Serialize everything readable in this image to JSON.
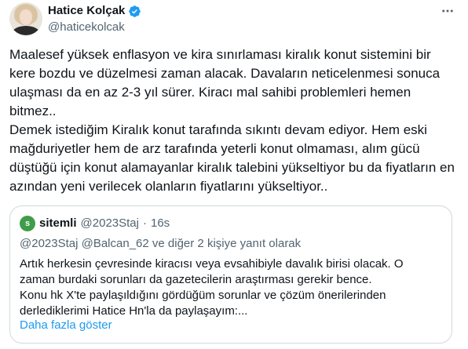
{
  "author": {
    "display_name": "Hatice Kolçak",
    "handle": "@haticekolcak",
    "verified_icon": "verified-badge-icon",
    "verified_color": "#1d9bf0"
  },
  "more_icon": "more-horizontal-icon",
  "tweet": {
    "paragraph_1": "Maalesef yüksek enflasyon ve kira sınırlaması kiralık konut sistemini bir kere bozdu ve düzelmesi zaman alacak. Davaların neticelenmesi sonuca ulaşması da en az 2-3 yıl sürer. Kiracı mal sahibi problemleri hemen bitmez..",
    "paragraph_2": "Demek istediğim Kiralık konut tarafında sıkıntı devam ediyor. Hem eski mağduriyetler hem de arz tarafında yeterli konut olmaması, alım gücü düştüğü için konut alamayanlar kiralık talebini yükseltiyor bu da fiyatların en azından yeni verilecek olanların fiyatlarını yükseltiyor.."
  },
  "quote": {
    "avatar_letter": "s",
    "avatar_color": "#3f9d4a",
    "name": "sitemli",
    "handle": "@2023Staj",
    "separator": "·",
    "time": "16s",
    "reply_to": "@2023Staj @Balcan_62  ve diğer 2 kişiye yanıt olarak",
    "text_lines": [
      "Artık herkesin çevresinde kiracısı veya evsahibiyle davalık birisi olacak. O",
      "zaman burdaki sorunları da gazetecilerin araştırması gerekir bence.",
      "Konu hk X'te paylaşıldığını gördüğüm sorunlar ve çözüm önerilerinden",
      "derlediklerimi Hatice Hn'la da paylaşayım:..."
    ],
    "show_more": "Daha fazla göster",
    "link_color": "#1d9bf0"
  }
}
